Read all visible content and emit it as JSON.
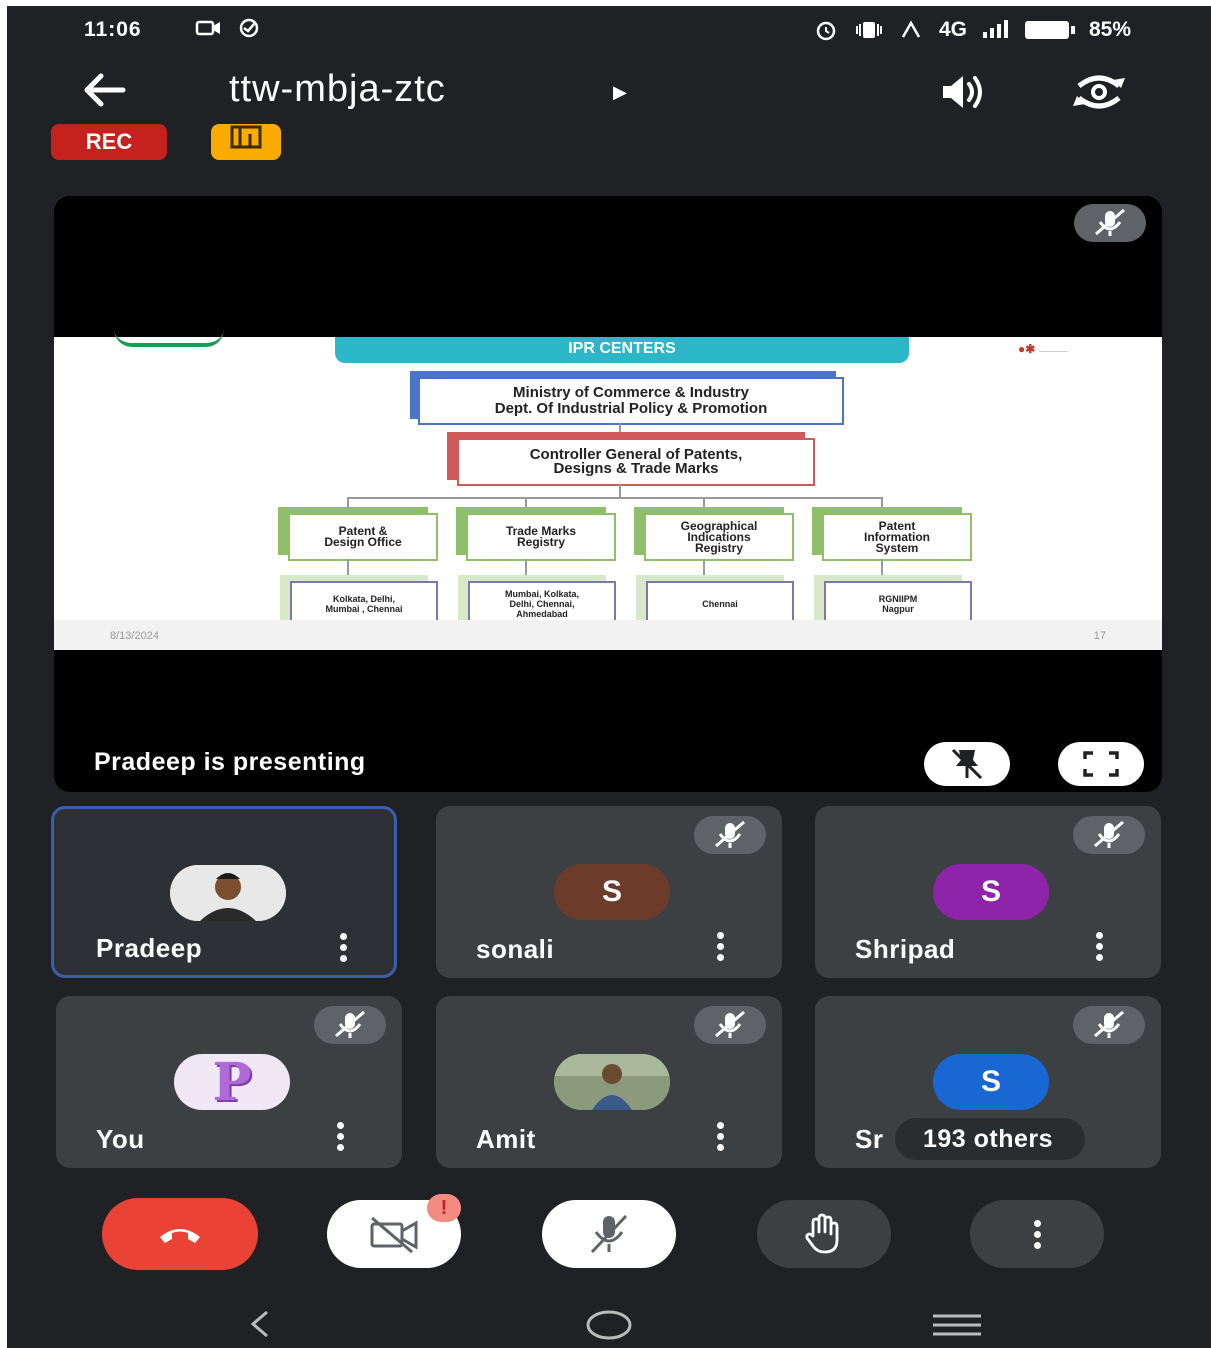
{
  "status_bar": {
    "time": "11:06",
    "network": "4G",
    "battery": "85%"
  },
  "meeting": {
    "code": "ttw-mbja-ztc",
    "rec_label": "REC"
  },
  "presentation": {
    "presenting_text": "Pradeep is presenting",
    "slide": {
      "banner": "IPR CENTERS",
      "ministry_line1": "Ministry of Commerce & Industry",
      "ministry_line2": "Dept. Of Industrial Policy & Promotion",
      "controller_line1": "Controller General of Patents,",
      "controller_line2": "Designs & Trade Marks",
      "offices": [
        {
          "l1": "Patent &",
          "l2": "Design  Office",
          "l3": ""
        },
        {
          "l1": "Trade Marks",
          "l2": "Registry",
          "l3": ""
        },
        {
          "l1": "Geographical",
          "l2": "Indications",
          "l3": "Registry"
        },
        {
          "l1": "Patent",
          "l2": "Information",
          "l3": "System"
        }
      ],
      "locations": [
        {
          "l1": "Kolkata, Delhi,",
          "l2": "Mumbai , Chennai",
          "l3": ""
        },
        {
          "l1": "Mumbai, Kolkata,",
          "l2": "Delhi, Chennai,",
          "l3": "Ahmedabad"
        },
        {
          "l1": "Chennai",
          "l2": "",
          "l3": ""
        },
        {
          "l1": "RGNIIPM",
          "l2": "Nagpur",
          "l3": ""
        }
      ],
      "date": "8/13/2024",
      "page": "17"
    }
  },
  "participants": [
    {
      "name": "Pradeep",
      "initial": "",
      "color": "#c8c8c8"
    },
    {
      "name": "sonali",
      "initial": "S",
      "color": "#6d3b2a"
    },
    {
      "name": "Shripad",
      "initial": "S",
      "color": "#8e24aa"
    },
    {
      "name": "You",
      "initial": "P",
      "color": "#b06ad8"
    },
    {
      "name": "Amit",
      "initial": "",
      "color": "#7a8a6a"
    },
    {
      "name": "Sr",
      "initial": "S",
      "color": "#1967d2"
    }
  ],
  "others_label": "193 others",
  "icons": {
    "back": "arrow-left-icon",
    "speaker": "speaker-icon",
    "switch_camera": "switch-camera-icon",
    "mic_off": "mic-off-icon",
    "unpin": "unpin-icon",
    "fullscreen": "fullscreen-icon",
    "end_call": "end-call-icon",
    "camera_off": "camera-off-icon",
    "raise_hand": "raise-hand-icon",
    "more": "more-vert-icon"
  },
  "colors": {
    "background": "#202124",
    "tile": "#3c4043",
    "rec": "#c5221f",
    "end_call": "#ea4335",
    "active_border": "#3b5ea8"
  }
}
